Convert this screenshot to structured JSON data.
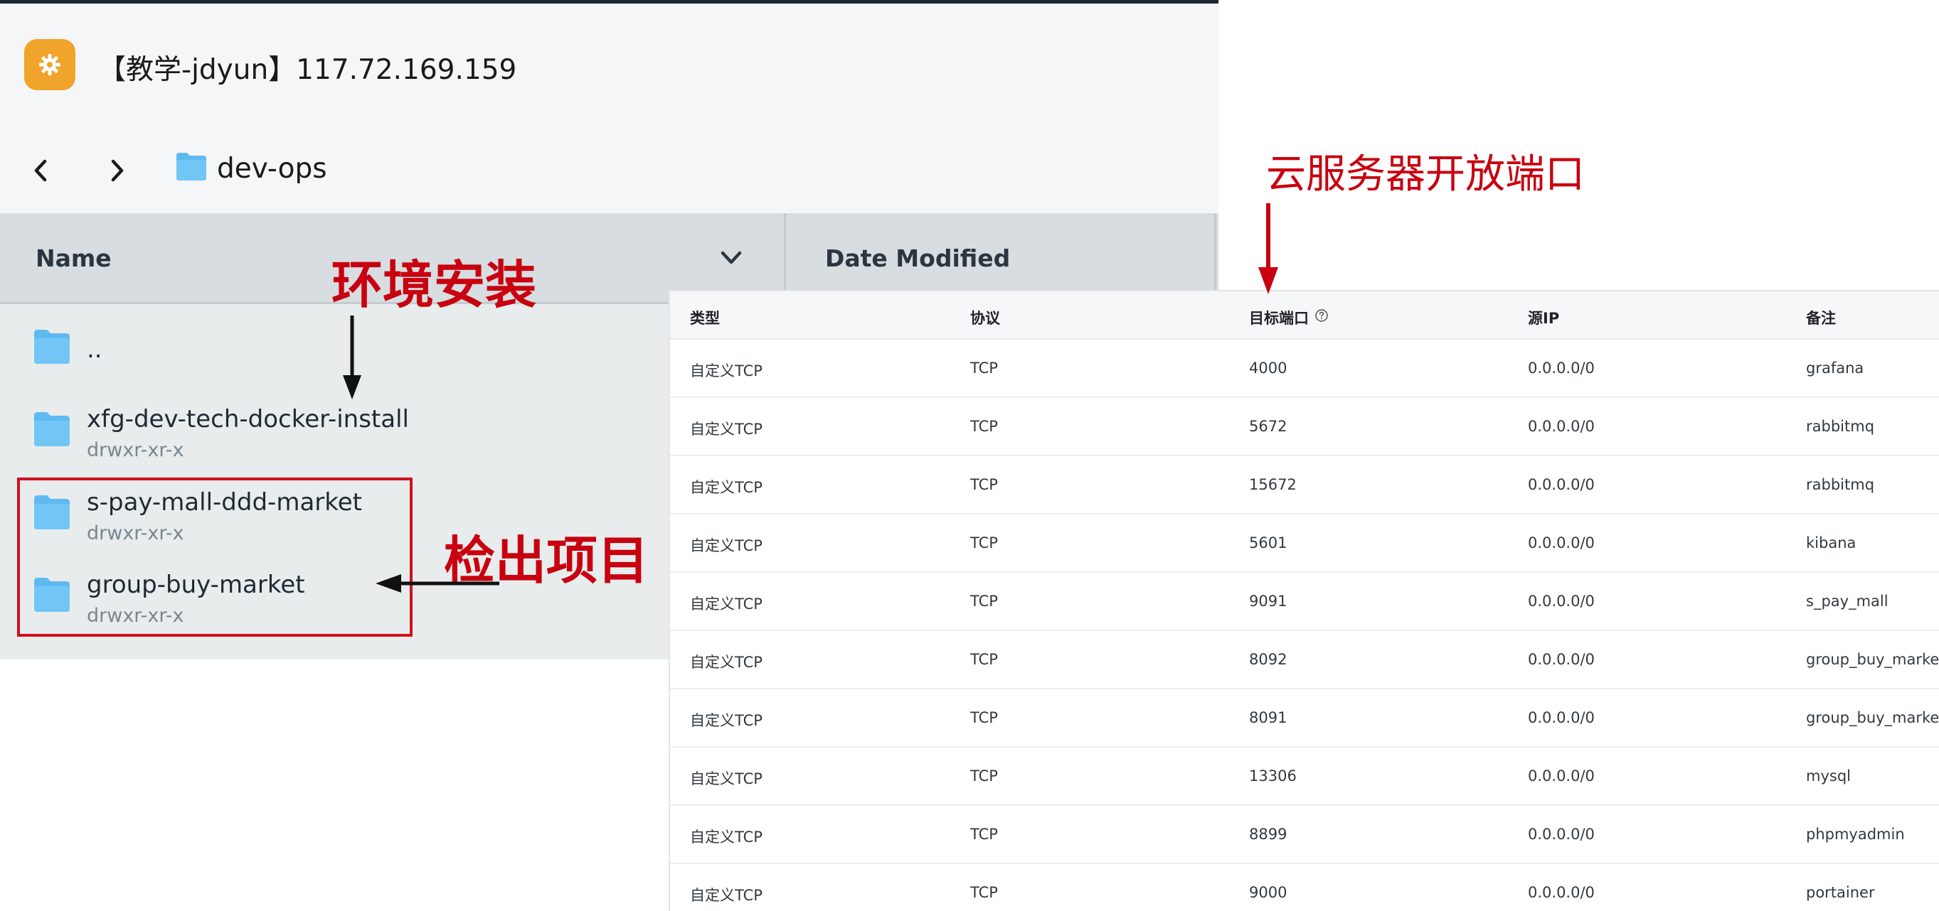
{
  "window": {
    "title": "【教学-jdyun】117.72.169.159",
    "app_icon": "gear-app-icon",
    "accent_color": "#f0a42c"
  },
  "navigation": {
    "back_icon": "chevron-left-icon",
    "forward_icon": "chevron-right-icon",
    "current_folder": "dev-ops"
  },
  "file_list": {
    "columns": {
      "name": "Name",
      "date_modified": "Date Modified"
    },
    "sort_icon": "chevron-down-icon",
    "rows": [
      {
        "name": "..",
        "permissions": ""
      },
      {
        "name": "xfg-dev-tech-docker-install",
        "permissions": "drwxr-xr-x"
      },
      {
        "name": "s-pay-mall-ddd-market",
        "permissions": "drwxr-xr-x"
      },
      {
        "name": "group-buy-market",
        "permissions": "drwxr-xr-x"
      }
    ]
  },
  "annotations": {
    "env_install": "环境安装",
    "checkout_projects": "检出项目",
    "cloud_ports": "云服务器开放端口",
    "color": "#c8000f"
  },
  "port_table": {
    "headers": [
      "类型",
      "协议",
      "目标端口",
      "源IP",
      "备注"
    ],
    "help_icon": "question-circle-icon",
    "rows": [
      [
        "自定义TCP",
        "TCP",
        "4000",
        "0.0.0.0/0",
        "grafana"
      ],
      [
        "自定义TCP",
        "TCP",
        "5672",
        "0.0.0.0/0",
        "rabbitmq"
      ],
      [
        "自定义TCP",
        "TCP",
        "15672",
        "0.0.0.0/0",
        "rabbitmq"
      ],
      [
        "自定义TCP",
        "TCP",
        "5601",
        "0.0.0.0/0",
        "kibana"
      ],
      [
        "自定义TCP",
        "TCP",
        "9091",
        "0.0.0.0/0",
        "s_pay_mall"
      ],
      [
        "自定义TCP",
        "TCP",
        "8092",
        "0.0.0.0/0",
        "group_buy_market"
      ],
      [
        "自定义TCP",
        "TCP",
        "8091",
        "0.0.0.0/0",
        "group_buy_market"
      ],
      [
        "自定义TCP",
        "TCP",
        "13306",
        "0.0.0.0/0",
        "mysql"
      ],
      [
        "自定义TCP",
        "TCP",
        "8899",
        "0.0.0.0/0",
        "phpmyadmin"
      ],
      [
        "自定义TCP",
        "TCP",
        "9000",
        "0.0.0.0/0",
        "portainer"
      ]
    ]
  }
}
